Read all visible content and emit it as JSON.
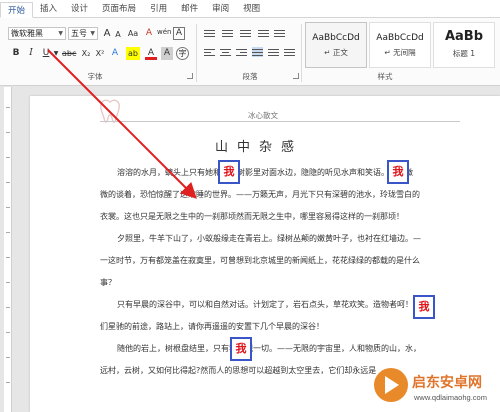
{
  "tabs": [
    "开始",
    "插入",
    "设计",
    "页面布局",
    "引用",
    "邮件",
    "审阅",
    "视图"
  ],
  "active_tab": "开始",
  "font": {
    "name": "微软雅黑",
    "size": "五号",
    "group_label": "字体"
  },
  "format_buttons": {
    "bold": "B",
    "italic": "I",
    "underline": "U",
    "grow": "A",
    "shrink": "A",
    "case": "Aa",
    "clear": "A",
    "phonetic": "wén",
    "border_char": "A",
    "highlight": "ab",
    "font_color": "A",
    "shade": "A",
    "circle_char": "字"
  },
  "paragraph": {
    "group_label": "段落"
  },
  "styles": {
    "group_label": "样式",
    "items": [
      {
        "sample": "AaBbCcDd",
        "name": "↵ 正文"
      },
      {
        "sample": "AaBbCcDd",
        "name": "↵ 无间隔"
      },
      {
        "sample": "AaBb",
        "name": "标题 1"
      }
    ]
  },
  "document": {
    "header_text": "冰心散文",
    "title": "山中杂感",
    "lines": [
      "溶溶的水月，螭头上只有她和我。树影里对面水边，隐隐的听见水声和笑语。我们微",
      "微的谈着，恐怕惊醒了这浓睡的世界。——万籁无声，月光下只有深碧的池水，玲珑雪白的",
      "衣裳。这也只是无限之生中的一刹那顷然而无限之生中，哪里容易得这样的一刹那顷！",
      "夕照里，牛羊下山了，小蚁般缘走在青岩上。绿树丛颠的嫩黄叶子，也衬在红墙边。—",
      "一这时节，万有都笼盖在寂寞里，可曾想到北京城里的新闻纸上，花花绿绿的都载的是什么",
      "事？",
      "只有早晨的深谷中，可以和自然对话。计划定了，岩石点头，草花欢笑。造物者呵！我",
      "们星驰的前途，路站上，请你再遥遥的安置下几个早晨的深谷！",
      "随他的岩上，树根盘结里，只有我能视一切。——无限的宇宙里，人和物质的山，水，",
      "远村，云树，又如何比得起?然而人的思想可以超越到太空里去，它们却永远是"
    ],
    "highlight_word": "我"
  },
  "watermark": {
    "title": "启东安卓网",
    "url": "www.qdlaimaohg.com"
  },
  "colors": {
    "accent": "#2b579a",
    "arrow": "#e02020",
    "box": "#3a55c8",
    "highlight": "#c6dcf2"
  }
}
